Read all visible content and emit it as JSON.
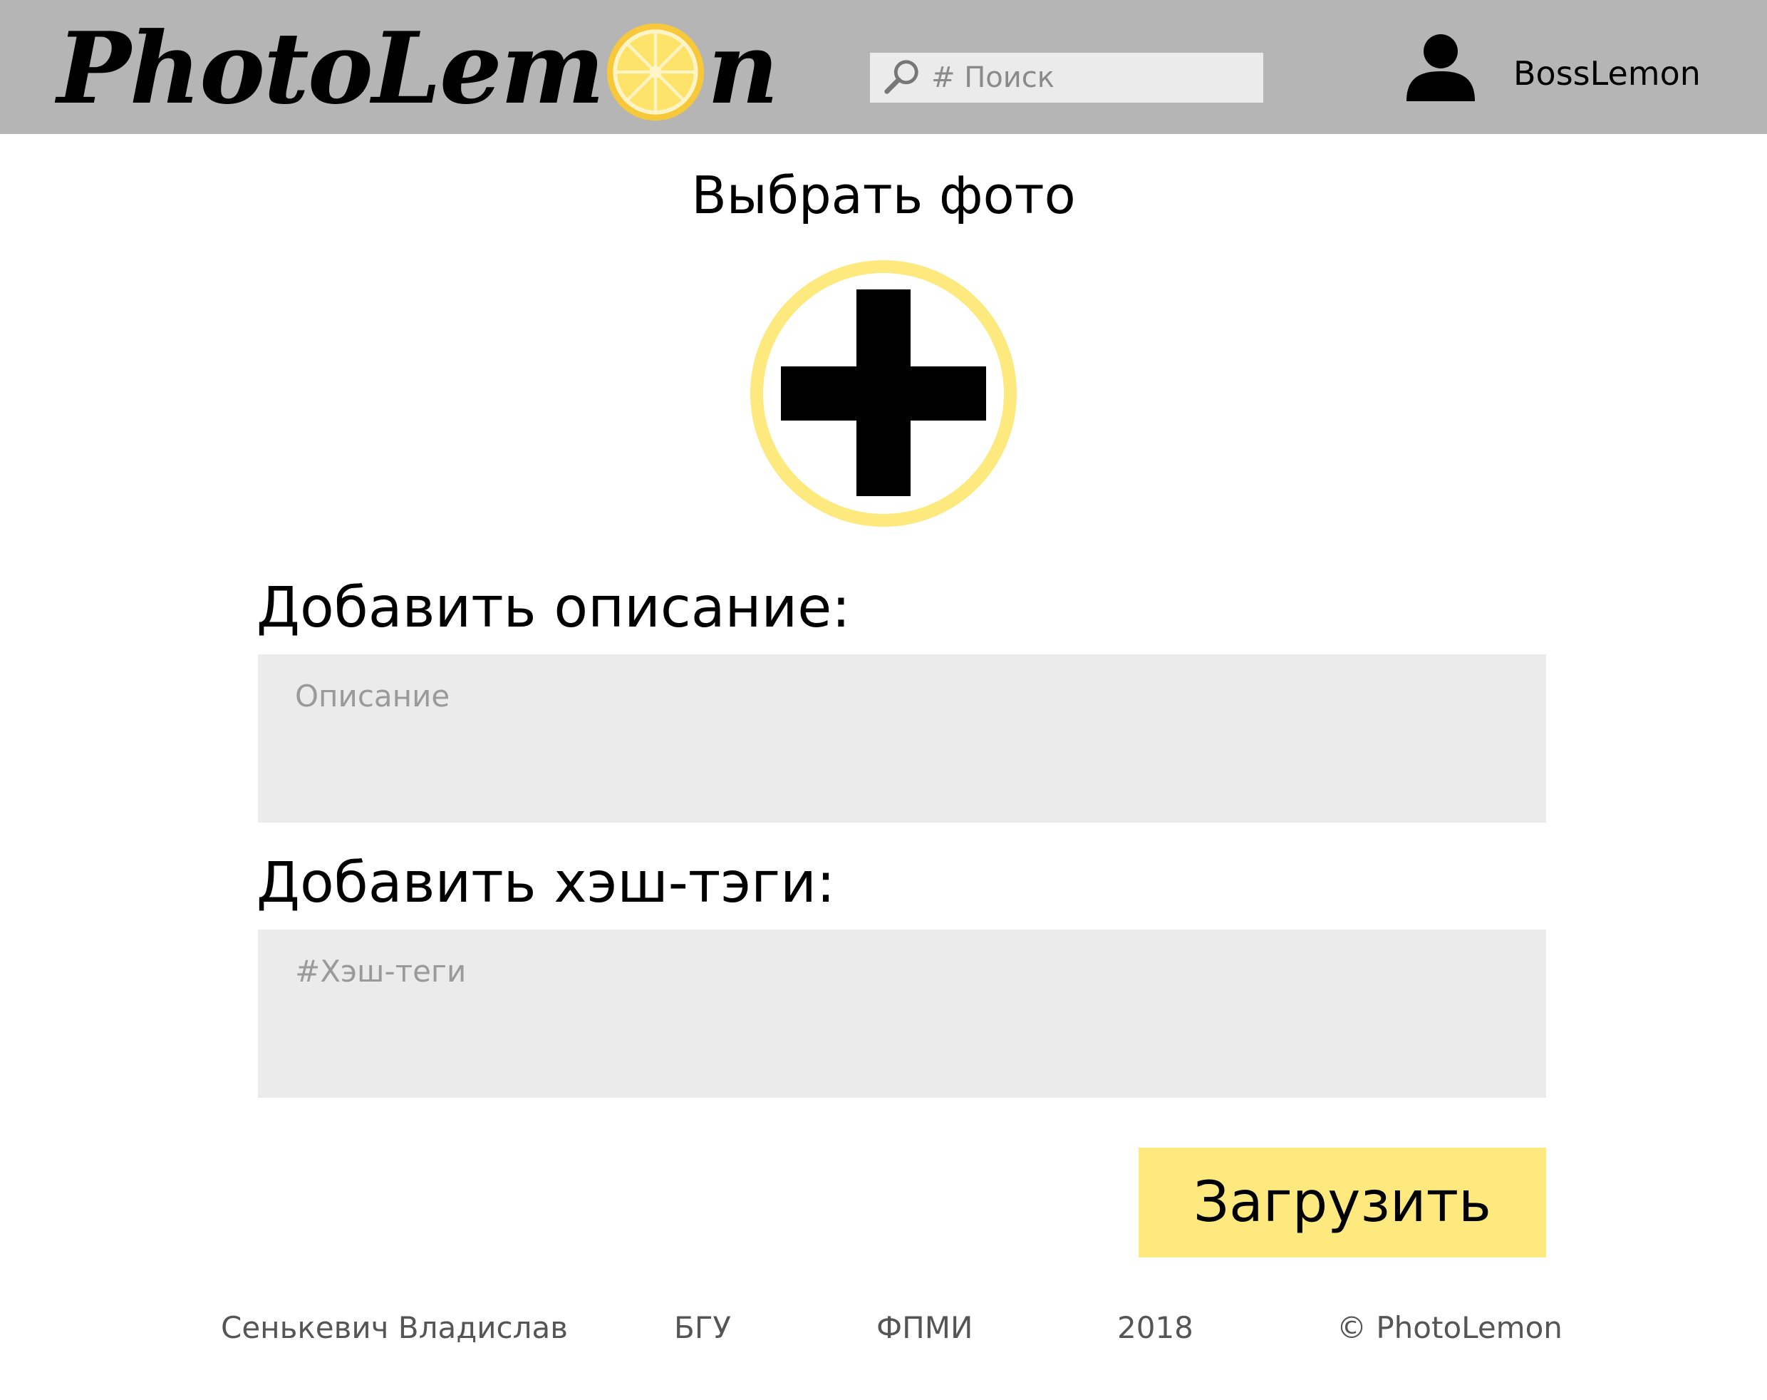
{
  "header": {
    "logo_text_before": "PhotoLem",
    "logo_text_after": "n",
    "search_placeholder": "# Поиск",
    "username": "BossLemon"
  },
  "main": {
    "choose_photo_title": "Выбрать фото",
    "description_label": "Добавить описание:",
    "description_placeholder": "Описание",
    "hashtags_label": "Добавить хэш-тэги:",
    "hashtags_placeholder": "#Хэш-теги",
    "upload_label": "Загрузить"
  },
  "footer": {
    "author": "Сенькевич Владислав",
    "university": "БГУ",
    "faculty": "ФПМИ",
    "year": "2018",
    "copyright": "© PhotoLemon"
  },
  "colors": {
    "header_bg": "#b5b5b5",
    "field_bg": "#ebebeb",
    "accent_yellow": "#fde97d"
  },
  "icons": {
    "logo_o": "lemon-slice-icon",
    "search": "search-icon",
    "user": "user-icon",
    "add_photo": "plus-icon"
  }
}
